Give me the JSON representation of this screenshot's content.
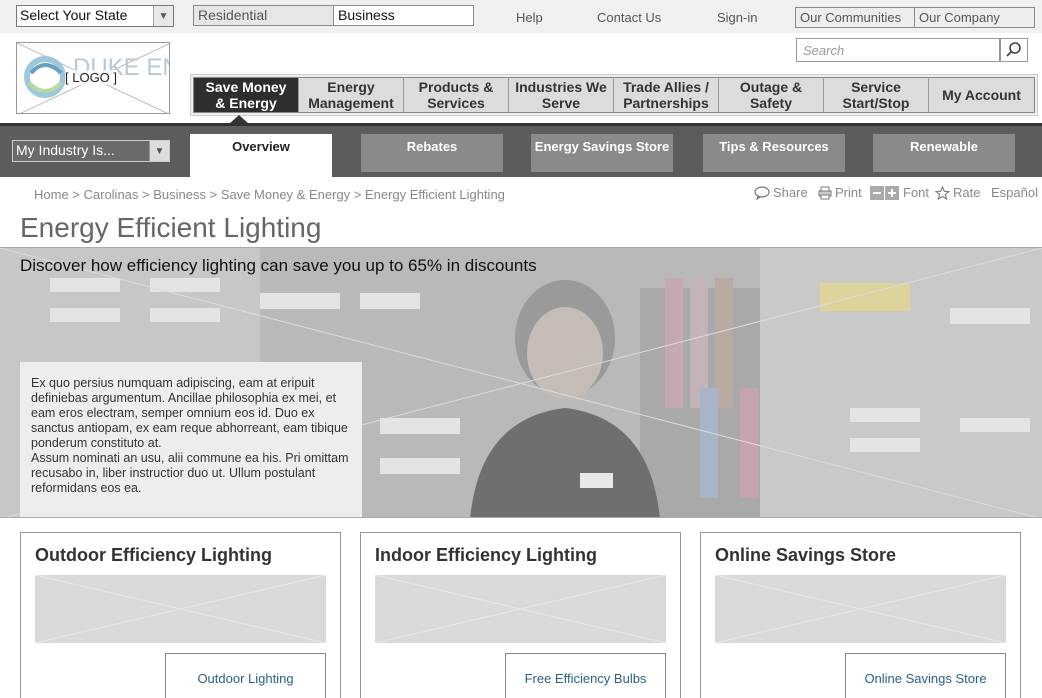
{
  "topbar": {
    "state_select": "Select Your State",
    "segment_residential": "Residential",
    "segment_business": "Business",
    "help": "Help",
    "contact": "Contact Us",
    "signin": "Sign-in",
    "communities": "Our Communities",
    "company": "Our Company"
  },
  "header": {
    "logo_text": "DUKE ENERGY",
    "logo_placeholder": "[ LOGO ]",
    "search_placeholder": "Search"
  },
  "mainnav": [
    {
      "line1": "Save Money",
      "line2": "& Energy",
      "active": true
    },
    {
      "line1": "Energy",
      "line2": "Management"
    },
    {
      "line1": "Products &",
      "line2": "Services"
    },
    {
      "line1": "Industries We",
      "line2": "Serve"
    },
    {
      "line1": "Trade Allies /",
      "line2": "Partnerships"
    },
    {
      "line1": "Outage &",
      "line2": "Safety"
    },
    {
      "line1": "Service",
      "line2": "Start/Stop"
    },
    {
      "line1": "My Account",
      "line2": ""
    }
  ],
  "subnav": {
    "industry_select": "My Industry Is...",
    "tabs": [
      "Overview",
      "Rebates",
      "Energy Savings Store",
      "Tips & Resources",
      "Renewable"
    ]
  },
  "breadcrumb": "Home > Carolinas > Business > Save Money & Energy > Energy Efficient Lighting",
  "tools": {
    "share": "Share",
    "print": "Print",
    "font": "Font",
    "rate": "Rate",
    "espanol": "Español"
  },
  "page_title": "Energy Efficient Lighting",
  "hero": {
    "headline": "Discover how efficiency lighting can save you up to 65% in discounts",
    "body1": "Ex quo persius numquam adipiscing, eam at eripuit definiebas argumentum. Ancillae philosophia ex mei, et eam eros electram, semper omnium eos id. Duo ex sanctus antiopam, ex eam reque abhorreant, eam tibique ponderum constituto at.",
    "body2": "Assum nominati an usu, alii commune ea his. Pri omittam recusabo in, liber instructior duo ut. Ullum postulant reformidans eos ea."
  },
  "cards": [
    {
      "title": "Outdoor Efficiency Lighting",
      "button": "Outdoor Lighting"
    },
    {
      "title": "Indoor Efficiency Lighting",
      "button": "Free Efficiency Bulbs"
    },
    {
      "title": "Online Savings Store",
      "button": "Online Savings Store"
    }
  ]
}
